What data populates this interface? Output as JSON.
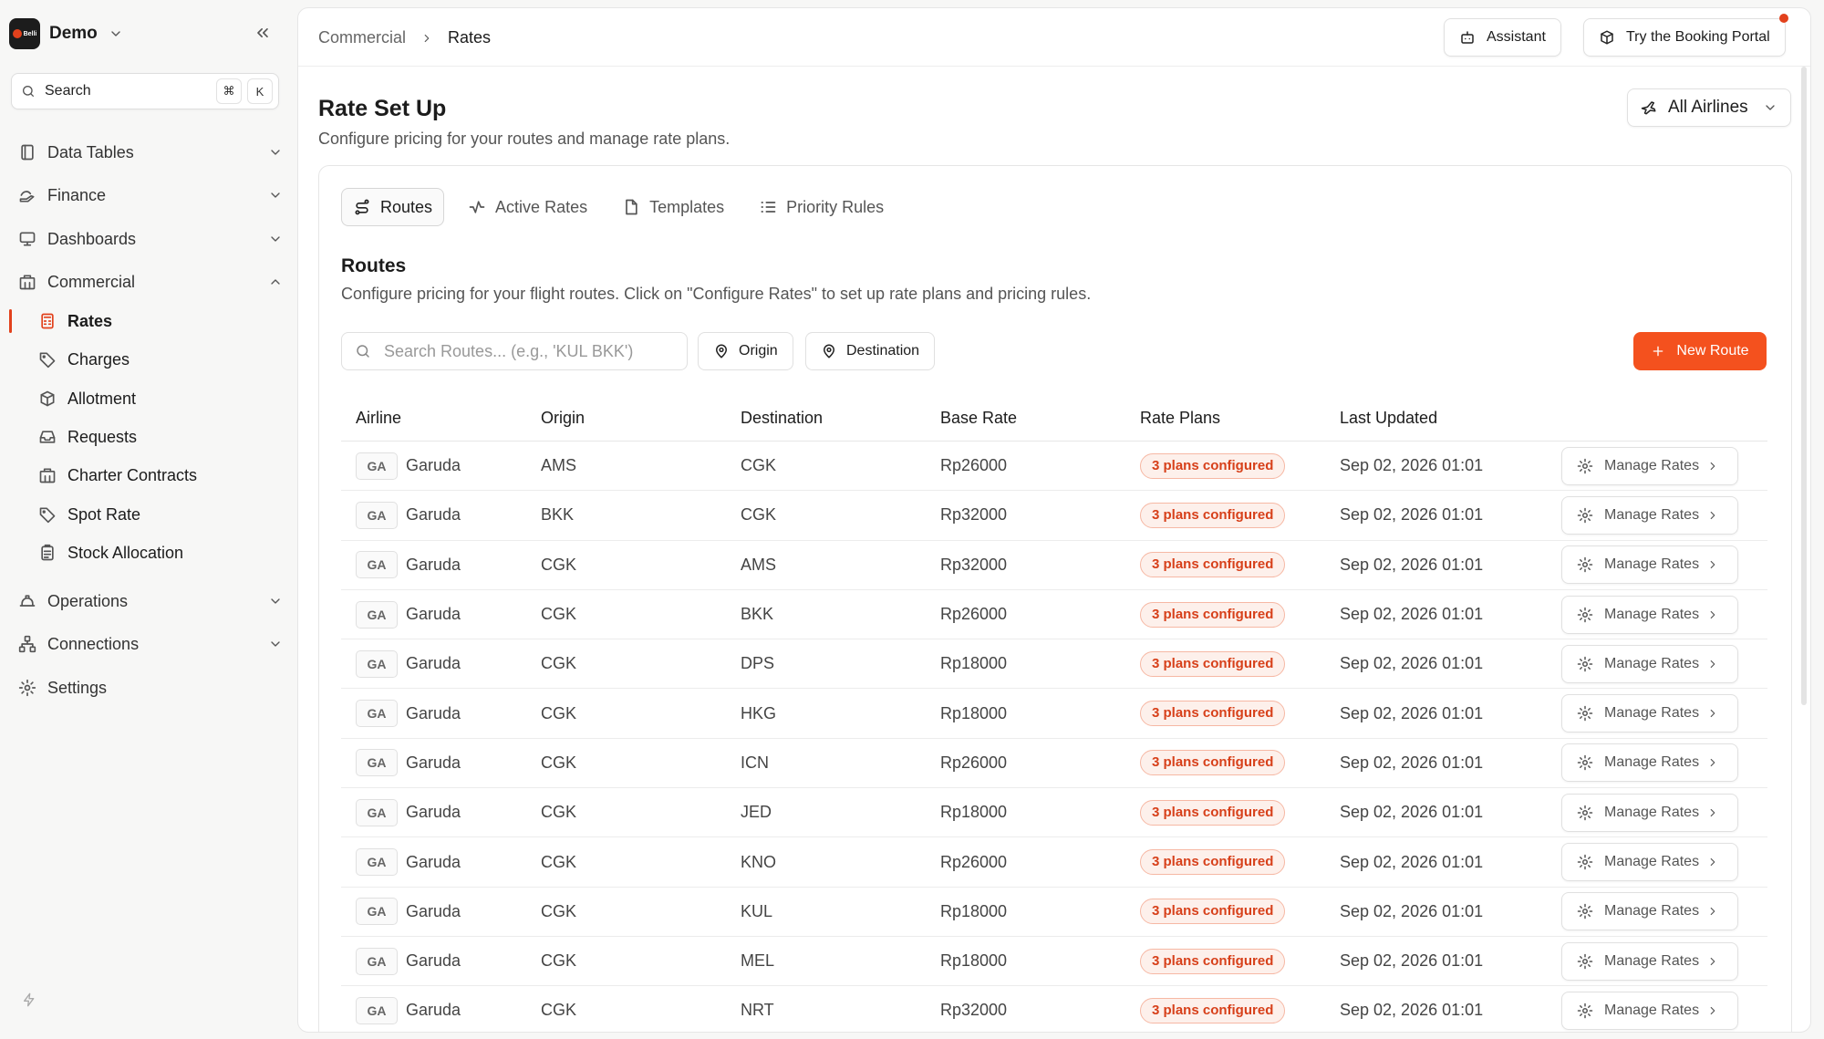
{
  "workspace": {
    "logo_text": "Belli",
    "name": "Demo"
  },
  "search": {
    "label": "Search",
    "shortcut_mod": "⌘",
    "shortcut_key": "K"
  },
  "sidebar": {
    "groups": [
      {
        "label": "Data Tables"
      },
      {
        "label": "Finance"
      },
      {
        "label": "Dashboards"
      },
      {
        "label": "Commercial"
      }
    ],
    "commercial_items": [
      {
        "label": "Rates"
      },
      {
        "label": "Charges"
      },
      {
        "label": "Allotment"
      },
      {
        "label": "Requests"
      },
      {
        "label": "Charter Contracts"
      },
      {
        "label": "Spot Rate"
      },
      {
        "label": "Stock Allocation"
      }
    ],
    "lower_groups": [
      {
        "label": "Operations"
      },
      {
        "label": "Connections"
      },
      {
        "label": "Settings"
      }
    ]
  },
  "breadcrumb": {
    "parent": "Commercial",
    "current": "Rates"
  },
  "topbar": {
    "assistant_label": "Assistant",
    "portal_label": "Try the Booking Portal"
  },
  "page": {
    "title": "Rate Set Up",
    "subtitle": "Configure pricing for your routes and manage rate plans.",
    "airline_filter": "All Airlines"
  },
  "tabs": [
    {
      "label": "Routes"
    },
    {
      "label": "Active Rates"
    },
    {
      "label": "Templates"
    },
    {
      "label": "Priority Rules"
    }
  ],
  "routes_section": {
    "title": "Routes",
    "subtitle": "Configure pricing for your flight routes. Click on \"Configure Rates\" to set up rate plans and pricing rules.",
    "search_placeholder": "Search Routes... (e.g., 'KUL BKK')",
    "origin_label": "Origin",
    "destination_label": "Destination",
    "new_route_label": "New Route"
  },
  "table": {
    "headers": [
      "Airline",
      "Origin",
      "Destination",
      "Base Rate",
      "Rate Plans",
      "Last Updated"
    ],
    "action_label": "Manage Rates",
    "rows": [
      {
        "code": "GA",
        "airline": "Garuda",
        "origin": "AMS",
        "destination": "CGK",
        "base_rate": "Rp26000",
        "plans": "3 plans configured",
        "updated": "Sep 02, 2026 01:01"
      },
      {
        "code": "GA",
        "airline": "Garuda",
        "origin": "BKK",
        "destination": "CGK",
        "base_rate": "Rp32000",
        "plans": "3 plans configured",
        "updated": "Sep 02, 2026 01:01"
      },
      {
        "code": "GA",
        "airline": "Garuda",
        "origin": "CGK",
        "destination": "AMS",
        "base_rate": "Rp32000",
        "plans": "3 plans configured",
        "updated": "Sep 02, 2026 01:01"
      },
      {
        "code": "GA",
        "airline": "Garuda",
        "origin": "CGK",
        "destination": "BKK",
        "base_rate": "Rp26000",
        "plans": "3 plans configured",
        "updated": "Sep 02, 2026 01:01"
      },
      {
        "code": "GA",
        "airline": "Garuda",
        "origin": "CGK",
        "destination": "DPS",
        "base_rate": "Rp18000",
        "plans": "3 plans configured",
        "updated": "Sep 02, 2026 01:01"
      },
      {
        "code": "GA",
        "airline": "Garuda",
        "origin": "CGK",
        "destination": "HKG",
        "base_rate": "Rp18000",
        "plans": "3 plans configured",
        "updated": "Sep 02, 2026 01:01"
      },
      {
        "code": "GA",
        "airline": "Garuda",
        "origin": "CGK",
        "destination": "ICN",
        "base_rate": "Rp26000",
        "plans": "3 plans configured",
        "updated": "Sep 02, 2026 01:01"
      },
      {
        "code": "GA",
        "airline": "Garuda",
        "origin": "CGK",
        "destination": "JED",
        "base_rate": "Rp18000",
        "plans": "3 plans configured",
        "updated": "Sep 02, 2026 01:01"
      },
      {
        "code": "GA",
        "airline": "Garuda",
        "origin": "CGK",
        "destination": "KNO",
        "base_rate": "Rp26000",
        "plans": "3 plans configured",
        "updated": "Sep 02, 2026 01:01"
      },
      {
        "code": "GA",
        "airline": "Garuda",
        "origin": "CGK",
        "destination": "KUL",
        "base_rate": "Rp18000",
        "plans": "3 plans configured",
        "updated": "Sep 02, 2026 01:01"
      },
      {
        "code": "GA",
        "airline": "Garuda",
        "origin": "CGK",
        "destination": "MEL",
        "base_rate": "Rp18000",
        "plans": "3 plans configured",
        "updated": "Sep 02, 2026 01:01"
      },
      {
        "code": "GA",
        "airline": "Garuda",
        "origin": "CGK",
        "destination": "NRT",
        "base_rate": "Rp32000",
        "plans": "3 plans configured",
        "updated": "Sep 02, 2026 01:01"
      }
    ]
  },
  "colors": {
    "accent": "#f4511e",
    "badge_text": "#d7401a",
    "badge_bg": "#fdf0eb"
  }
}
